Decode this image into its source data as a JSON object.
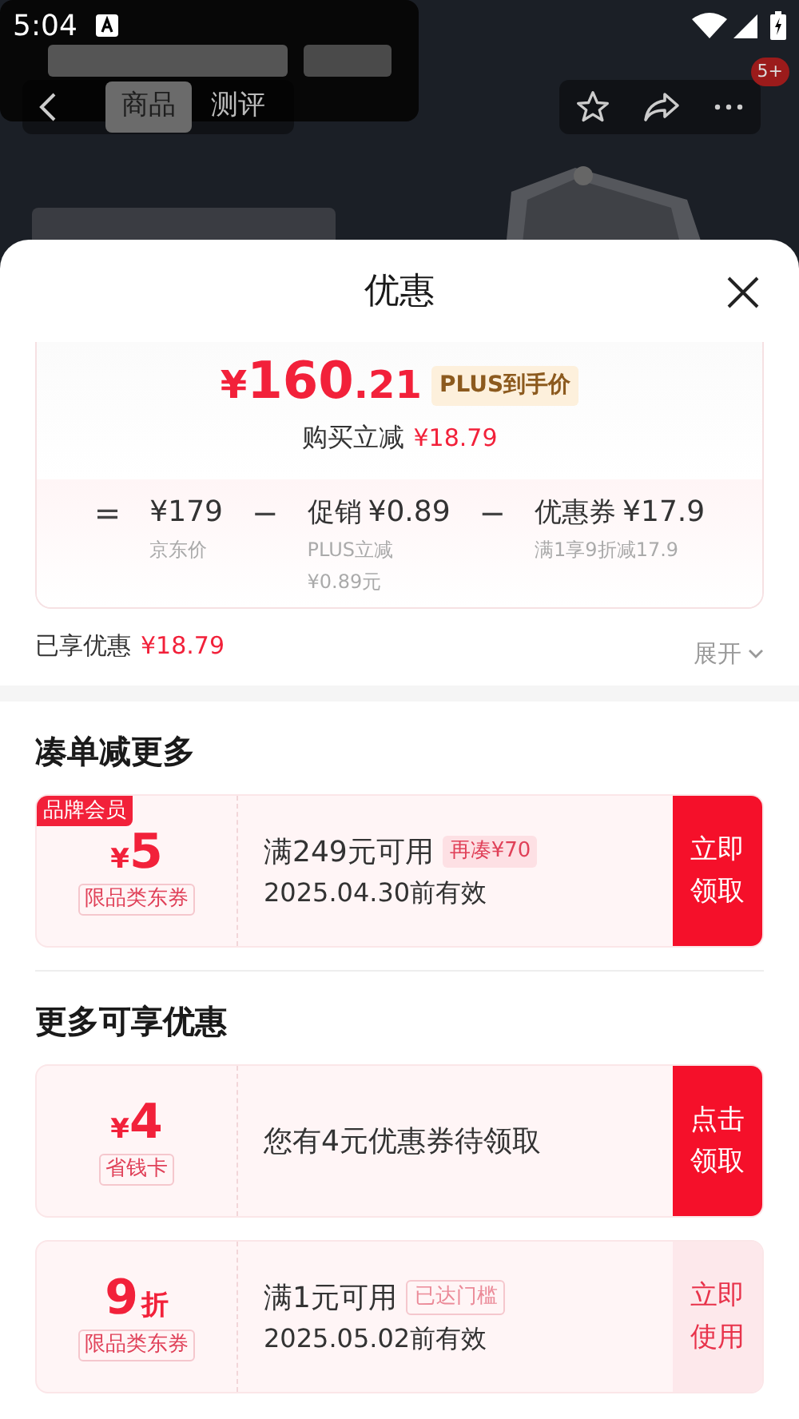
{
  "status_bar": {
    "time": "5:04"
  },
  "nav": {
    "tabs": [
      {
        "label": "商品",
        "selected": true
      },
      {
        "label": "测评",
        "selected": false
      }
    ],
    "badge": "5+"
  },
  "sheet": {
    "title": "优惠",
    "price": {
      "currency": "¥",
      "integer": "160",
      "decimal": ".21",
      "tag": "PLUS到手价",
      "saving_label": "购买立减",
      "saving_value": "¥18.79",
      "breakdown": [
        {
          "kind": "operator",
          "symbol": "="
        },
        {
          "kind": "term",
          "value": "¥179",
          "notes": [
            "京东价"
          ]
        },
        {
          "kind": "operator",
          "symbol": "−"
        },
        {
          "kind": "term",
          "label": "促销",
          "value": "¥0.89",
          "notes": [
            "PLUS立减",
            "¥0.89元"
          ]
        },
        {
          "kind": "operator",
          "symbol": "−"
        },
        {
          "kind": "term",
          "label": "优惠券",
          "value": "¥17.9",
          "notes": [
            "满1享9折减17.9"
          ]
        }
      ]
    },
    "enjoyed": {
      "label": "已享优惠",
      "value": "¥18.79",
      "expand": "展开"
    },
    "sections": [
      {
        "title": "凑单减更多",
        "coupons": [
          {
            "kind": "claim",
            "tag": "品牌会员",
            "prefix": "¥",
            "amount": "5",
            "scope": "限品类东券",
            "condition": "满249元可用",
            "hint": {
              "kind": "filled",
              "text": "再凑¥70"
            },
            "validity": "2025.04.30前有效",
            "action": [
              "立即",
              "领取"
            ]
          }
        ]
      },
      {
        "title": "更多可享优惠",
        "coupons": [
          {
            "kind": "claim",
            "prefix": "¥",
            "amount": "4",
            "scope": "省钱卡",
            "condition": "您有4元优惠券待领取",
            "action": [
              "点击",
              "领取"
            ]
          },
          {
            "kind": "use",
            "amount": "9",
            "suffix": "折",
            "scope": "限品类东券",
            "condition": "满1元可用",
            "hint": {
              "kind": "outline",
              "text": "已达门槛"
            },
            "validity": "2025.05.02前有效",
            "action": [
              "立即",
              "使用"
            ]
          }
        ]
      }
    ]
  }
}
